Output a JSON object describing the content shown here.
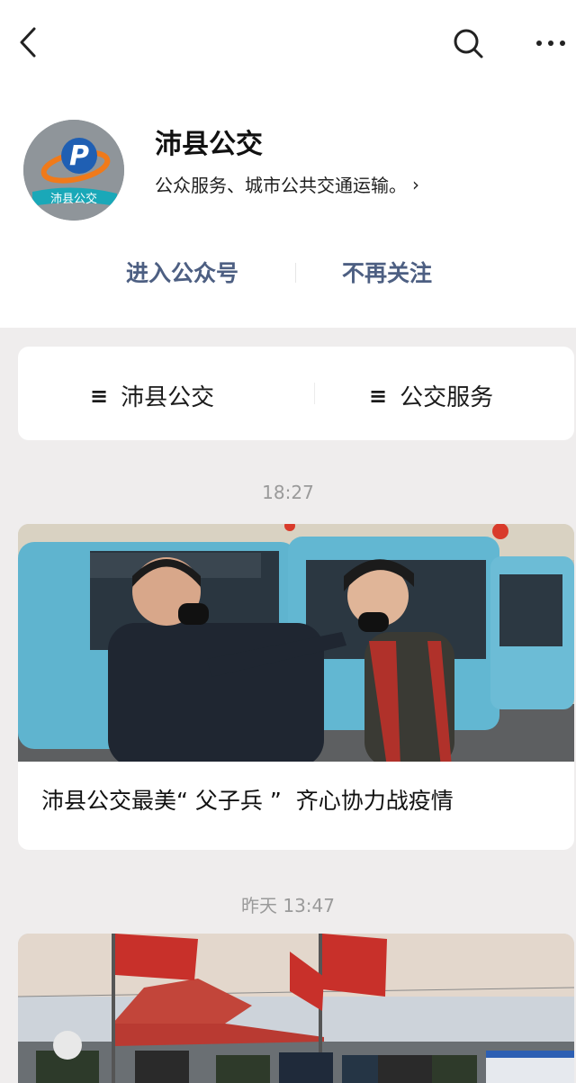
{
  "account": {
    "name": "沛县公交",
    "description": "公众服务、城市公共交通运输。",
    "logo_letter": "P",
    "logo_caption": "沛县公交"
  },
  "actions": {
    "enter": "进入公众号",
    "unfollow": "不再关注"
  },
  "menu": {
    "items": [
      {
        "label": "沛县公交",
        "icon": "menu-icon"
      },
      {
        "label": "公交服务",
        "icon": "menu-icon"
      }
    ]
  },
  "feed": [
    {
      "time": "18:27",
      "title": "沛县公交最美“ 父子兵 ”  齐心协力战疫情"
    },
    {
      "time": "昨天 13:47"
    }
  ],
  "colors": {
    "link_blue": "#4d5f82",
    "timestamp_gray": "#9a9a9a",
    "page_bg": "#efeded"
  }
}
